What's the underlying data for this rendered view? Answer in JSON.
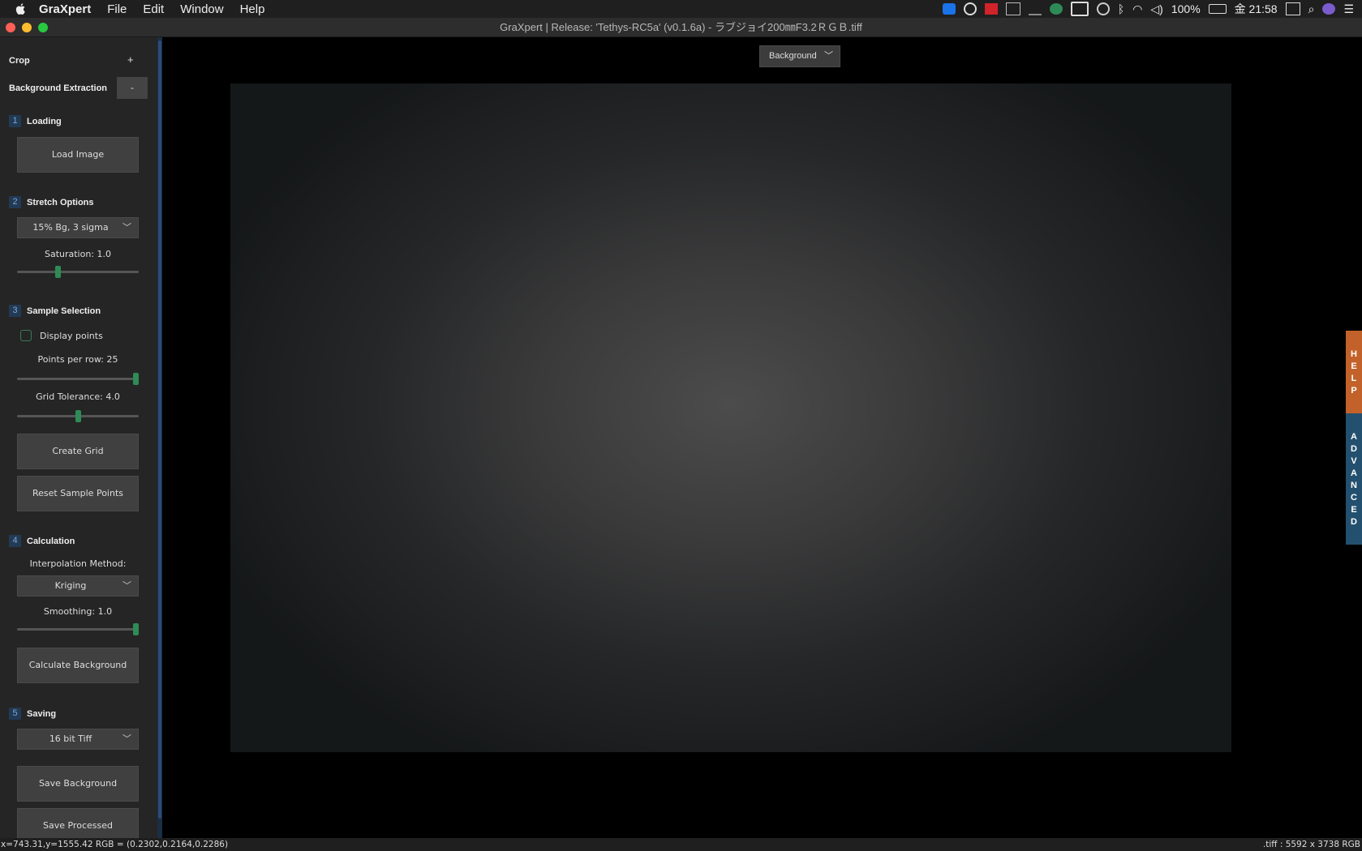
{
  "menubar": {
    "app_name": "GraXpert",
    "items": [
      "File",
      "Edit",
      "Window",
      "Help"
    ],
    "battery": "100%",
    "clock": "金 21:58"
  },
  "window": {
    "title": "GraXpert | Release: 'Tethys-RC5a' (v0.1.6a) - ラブジョイ200㎜F3.2ＲＧＢ.tiff"
  },
  "sidebar": {
    "crop": {
      "label": "Crop",
      "toggle": "+"
    },
    "bg_extraction": {
      "label": "Background Extraction",
      "toggle": "-"
    },
    "loading": {
      "num": "1",
      "title": "Loading",
      "load_button": "Load Image"
    },
    "stretch": {
      "num": "2",
      "title": "Stretch Options",
      "selected": "15% Bg, 3 sigma",
      "saturation_label": "Saturation: 1.0",
      "saturation_value": 1.0,
      "saturation_min": 0,
      "saturation_max": 3
    },
    "sample": {
      "num": "3",
      "title": "Sample Selection",
      "display_points_label": "Display points",
      "display_points_checked": false,
      "points_per_row_label": "Points per row: 25",
      "points_per_row_fraction": 0.97,
      "grid_tolerance_label": "Grid Tolerance: 4.0",
      "grid_tolerance_fraction": 0.5,
      "create_grid_button": "Create Grid",
      "reset_points_button": "Reset Sample Points"
    },
    "calculation": {
      "num": "4",
      "title": "Calculation",
      "interp_label": "Interpolation Method:",
      "interp_selected": "Kriging",
      "smoothing_label": "Smoothing: 1.0",
      "smoothing_fraction": 0.97,
      "calc_button": "Calculate Background"
    },
    "saving": {
      "num": "5",
      "title": "Saving",
      "format_selected": "16 bit Tiff",
      "save_bg_button": "Save Background",
      "save_processed_button": "Save Processed"
    }
  },
  "main": {
    "view_selector": "Background",
    "help_tab": "HELP",
    "advanced_tab": "ADVANCED"
  },
  "statusbar": {
    "cursor_info": "x=743.31,y=1555.42  RGB = (0.2302,0.2164,0.2286)",
    "file_info": ".tiff : 5592 x 3738 RGB"
  },
  "colors": {
    "accent_green": "#2e8b57",
    "help_tab": "#c2622a",
    "advanced_tab": "#23506e"
  }
}
